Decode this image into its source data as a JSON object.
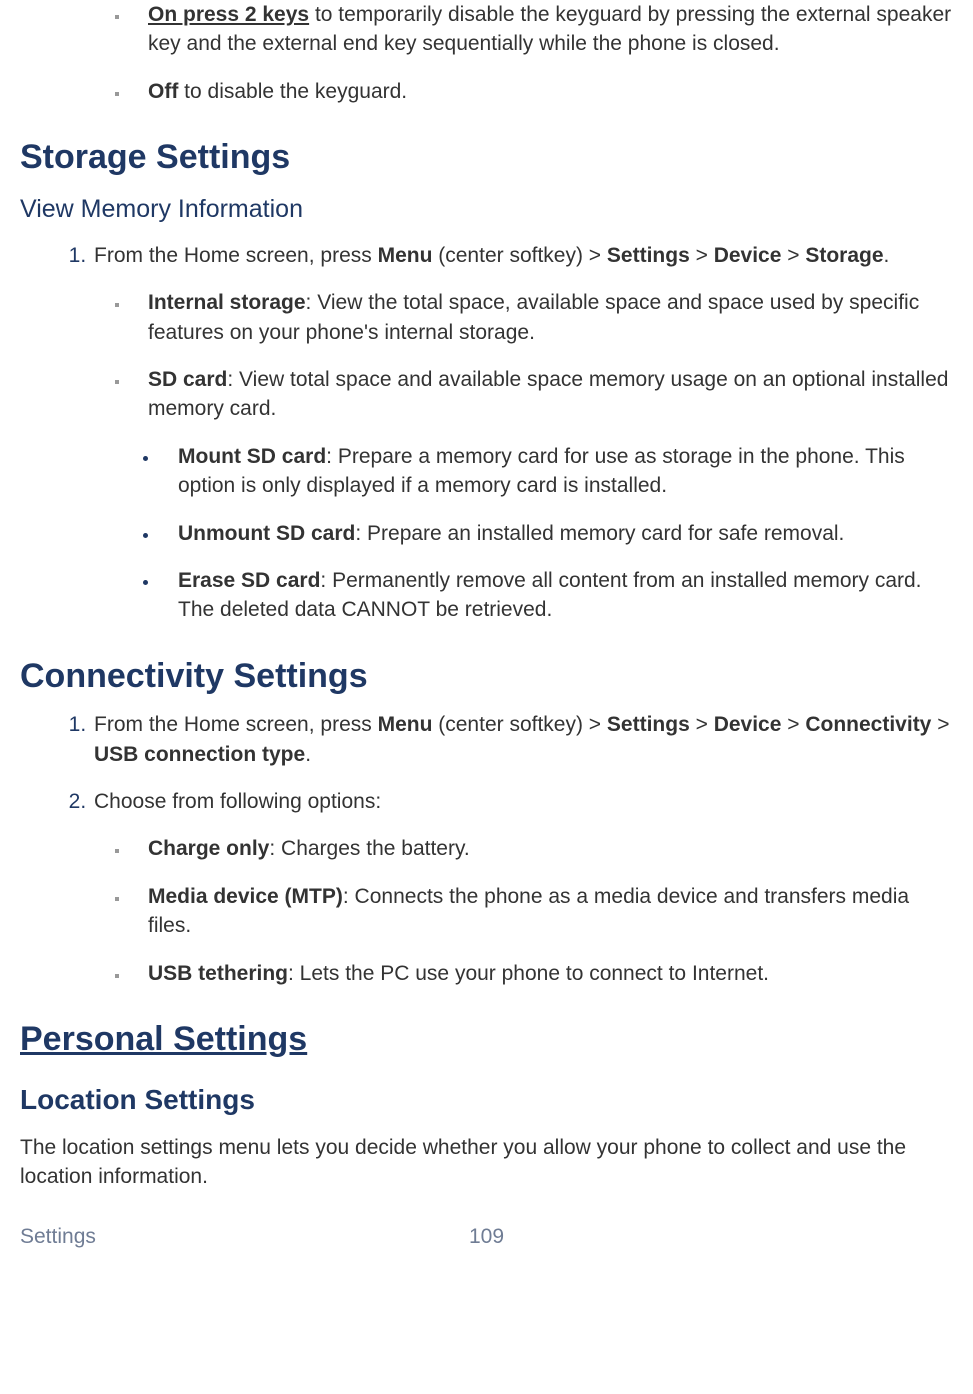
{
  "intro_items": [
    {
      "bold": "On press 2 keys",
      "boldUnderline": true,
      "rest": " to temporarily disable the keyguard by pressing the external speaker key and the external end key sequentially while the phone is closed."
    },
    {
      "bold": "Off",
      "rest": " to disable the keyguard."
    }
  ],
  "storage": {
    "heading": "Storage Settings",
    "subheading": "View Memory Information",
    "step1": {
      "pre": "From the Home screen, press ",
      "b1": "Menu",
      "mid1": " (center softkey) > ",
      "b2": "Settings",
      "mid2": " > ",
      "b3": "Device",
      "mid3": " > ",
      "b4": "Storage",
      "end": "."
    },
    "items": [
      {
        "bold": "Internal storage",
        "rest": ": View the total space, available space and space used by specific features on your phone's internal storage."
      },
      {
        "bold": "SD card",
        "rest": ": View total space and available space memory usage on an optional installed memory card."
      }
    ],
    "sub_items": [
      {
        "bold": "Mount SD card",
        "rest": ": Prepare a memory card for use as storage in the phone. This option is only displayed if a memory card is installed."
      },
      {
        "bold": "Unmount SD card",
        "rest": ": Prepare an installed memory card for safe removal."
      },
      {
        "bold": "Erase SD card",
        "rest": ": Permanently remove all content from an installed memory card. The deleted data CANNOT be retrieved."
      }
    ]
  },
  "connectivity": {
    "heading": "Connectivity Settings",
    "step1": {
      "pre": "From the Home screen, press ",
      "b1": "Menu",
      "mid1": " (center softkey) > ",
      "b2": "Settings",
      "mid2": " > ",
      "b3": "Device",
      "mid3": " > ",
      "b4": "Connectivity",
      "mid4": " > ",
      "b5": "USB connection type",
      "end": "."
    },
    "step2": "Choose from following options:",
    "items": [
      {
        "bold": "Charge only",
        "rest": ": Charges the battery."
      },
      {
        "bold": "Media device (MTP)",
        "rest": ": Connects the phone as a media device and transfers media files."
      },
      {
        "bold": "USB tethering",
        "rest": ": Lets the PC use your phone to connect to Internet."
      }
    ]
  },
  "personal": {
    "heading": "Personal Settings",
    "sub_heading": "Location Settings",
    "paragraph": "The location settings menu lets you decide whether you allow your phone to collect and use the location information."
  },
  "footer": {
    "left": "Settings",
    "page": "109"
  }
}
